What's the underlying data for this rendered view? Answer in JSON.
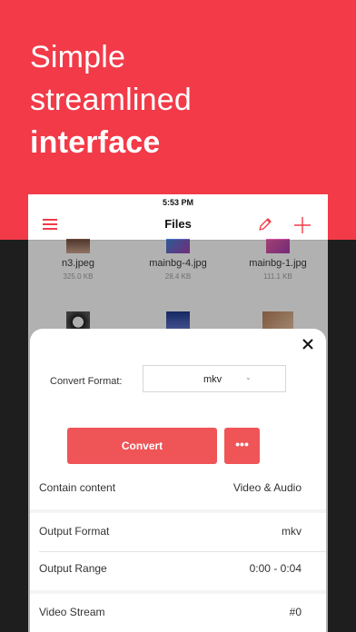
{
  "hero": {
    "line1": "Simple",
    "line2": "streamlined",
    "line3": "interface"
  },
  "status": {
    "time": "5:53 PM"
  },
  "nav": {
    "title": "Files",
    "menu_icon": "hamburger-menu-icon",
    "edit_icon": "pencil-icon",
    "add_icon": "plus-icon"
  },
  "files": [
    {
      "name": "n3.jpeg",
      "size": "325.0 KB"
    },
    {
      "name": "mainbg-4.jpg",
      "size": "28.4 KB"
    },
    {
      "name": "mainbg-1.jpg",
      "size": "111.1 KB"
    }
  ],
  "sheet": {
    "format_label": "Convert Format:",
    "format_value": "mkv",
    "convert_label": "Convert",
    "more_label": "•••",
    "rows": [
      {
        "key": "Contain content",
        "value": "Video & Audio"
      },
      {
        "key": "Output Format",
        "value": "mkv"
      },
      {
        "key": "Output Range",
        "value": "0:00 - 0:04"
      },
      {
        "key": "Video Stream",
        "value": "#0"
      }
    ]
  },
  "colors": {
    "brand": "#f23a48",
    "button": "#ef5457"
  }
}
